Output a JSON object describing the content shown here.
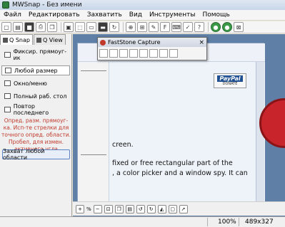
{
  "window": {
    "title": "MWSnap - Без имени"
  },
  "menu": [
    "Файл",
    "Редактировать",
    "Захватить",
    "Вид",
    "Инструменты",
    "Помощь"
  ],
  "toolbar_icons": [
    "new-icon",
    "open-icon",
    "save-icon",
    "print-icon",
    "copy-icon",
    "grab-fixed-icon",
    "grab-any-icon",
    "grab-window-icon",
    "grab-desktop-icon",
    "repeat-icon",
    "zoom-icon",
    "ruler-icon",
    "color-picker-icon",
    "font-icon",
    "keyboard-icon",
    "settings-icon",
    "help-icon",
    "lock-icon",
    "pin-icon",
    "exit-icon"
  ],
  "panel": {
    "tabs": [
      {
        "label": "Q Snap",
        "active": true
      },
      {
        "label": "Q View",
        "active": false
      }
    ],
    "options": [
      {
        "label": "Фиксир. прямоуг-ик",
        "active": false
      },
      {
        "label": "Любой размер",
        "active": true
      },
      {
        "label": "Окно/меню",
        "active": false
      },
      {
        "label": "Полный раб. стол",
        "active": false
      },
      {
        "label": "Повтор последнего",
        "active": false
      }
    ],
    "hint": "Опред. разм. прямоуг-ка. Исп-те стрелки для точного опред. области. Пробел, для измен. активного угла",
    "grab_button": "Захват любой области"
  },
  "faststone": {
    "title": "FastStone Capture",
    "close": "×"
  },
  "document": {
    "paypal_logo": "PayPal",
    "paypal_donate": "DONATE",
    "lines": [
      "creen.",
      "fixed or free rectangular part of the",
      ", a color picker and a window spy. It can"
    ]
  },
  "bottom_toolbar": {
    "zoom_label": "100%",
    "zoom_hint": "%"
  },
  "status": {
    "zoom": "100%",
    "dimensions": "489x327"
  }
}
